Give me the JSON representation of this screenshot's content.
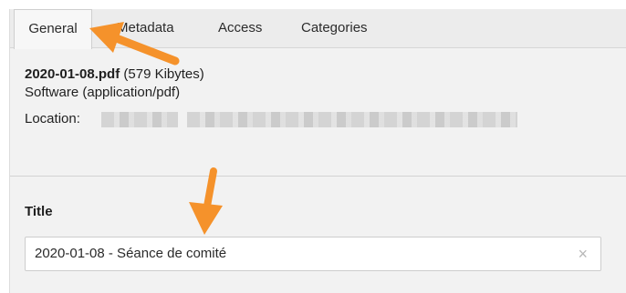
{
  "tabs": [
    {
      "label": "General",
      "active": true
    },
    {
      "label": "Metadata",
      "active": false
    },
    {
      "label": "Access",
      "active": false
    },
    {
      "label": "Categories",
      "active": false
    }
  ],
  "file": {
    "name": "2020-01-08.pdf",
    "size": "(579 Kibytes)",
    "type": "Software (application/pdf)",
    "location_label": "Location:"
  },
  "title_section": {
    "label": "Title",
    "value": "2020-01-08 - Séance de comité",
    "clear_icon": "×"
  },
  "colors": {
    "annotation_arrow": "#f5922b"
  },
  "icons": [
    "clear-icon",
    "annotation-arrow-icon"
  ]
}
